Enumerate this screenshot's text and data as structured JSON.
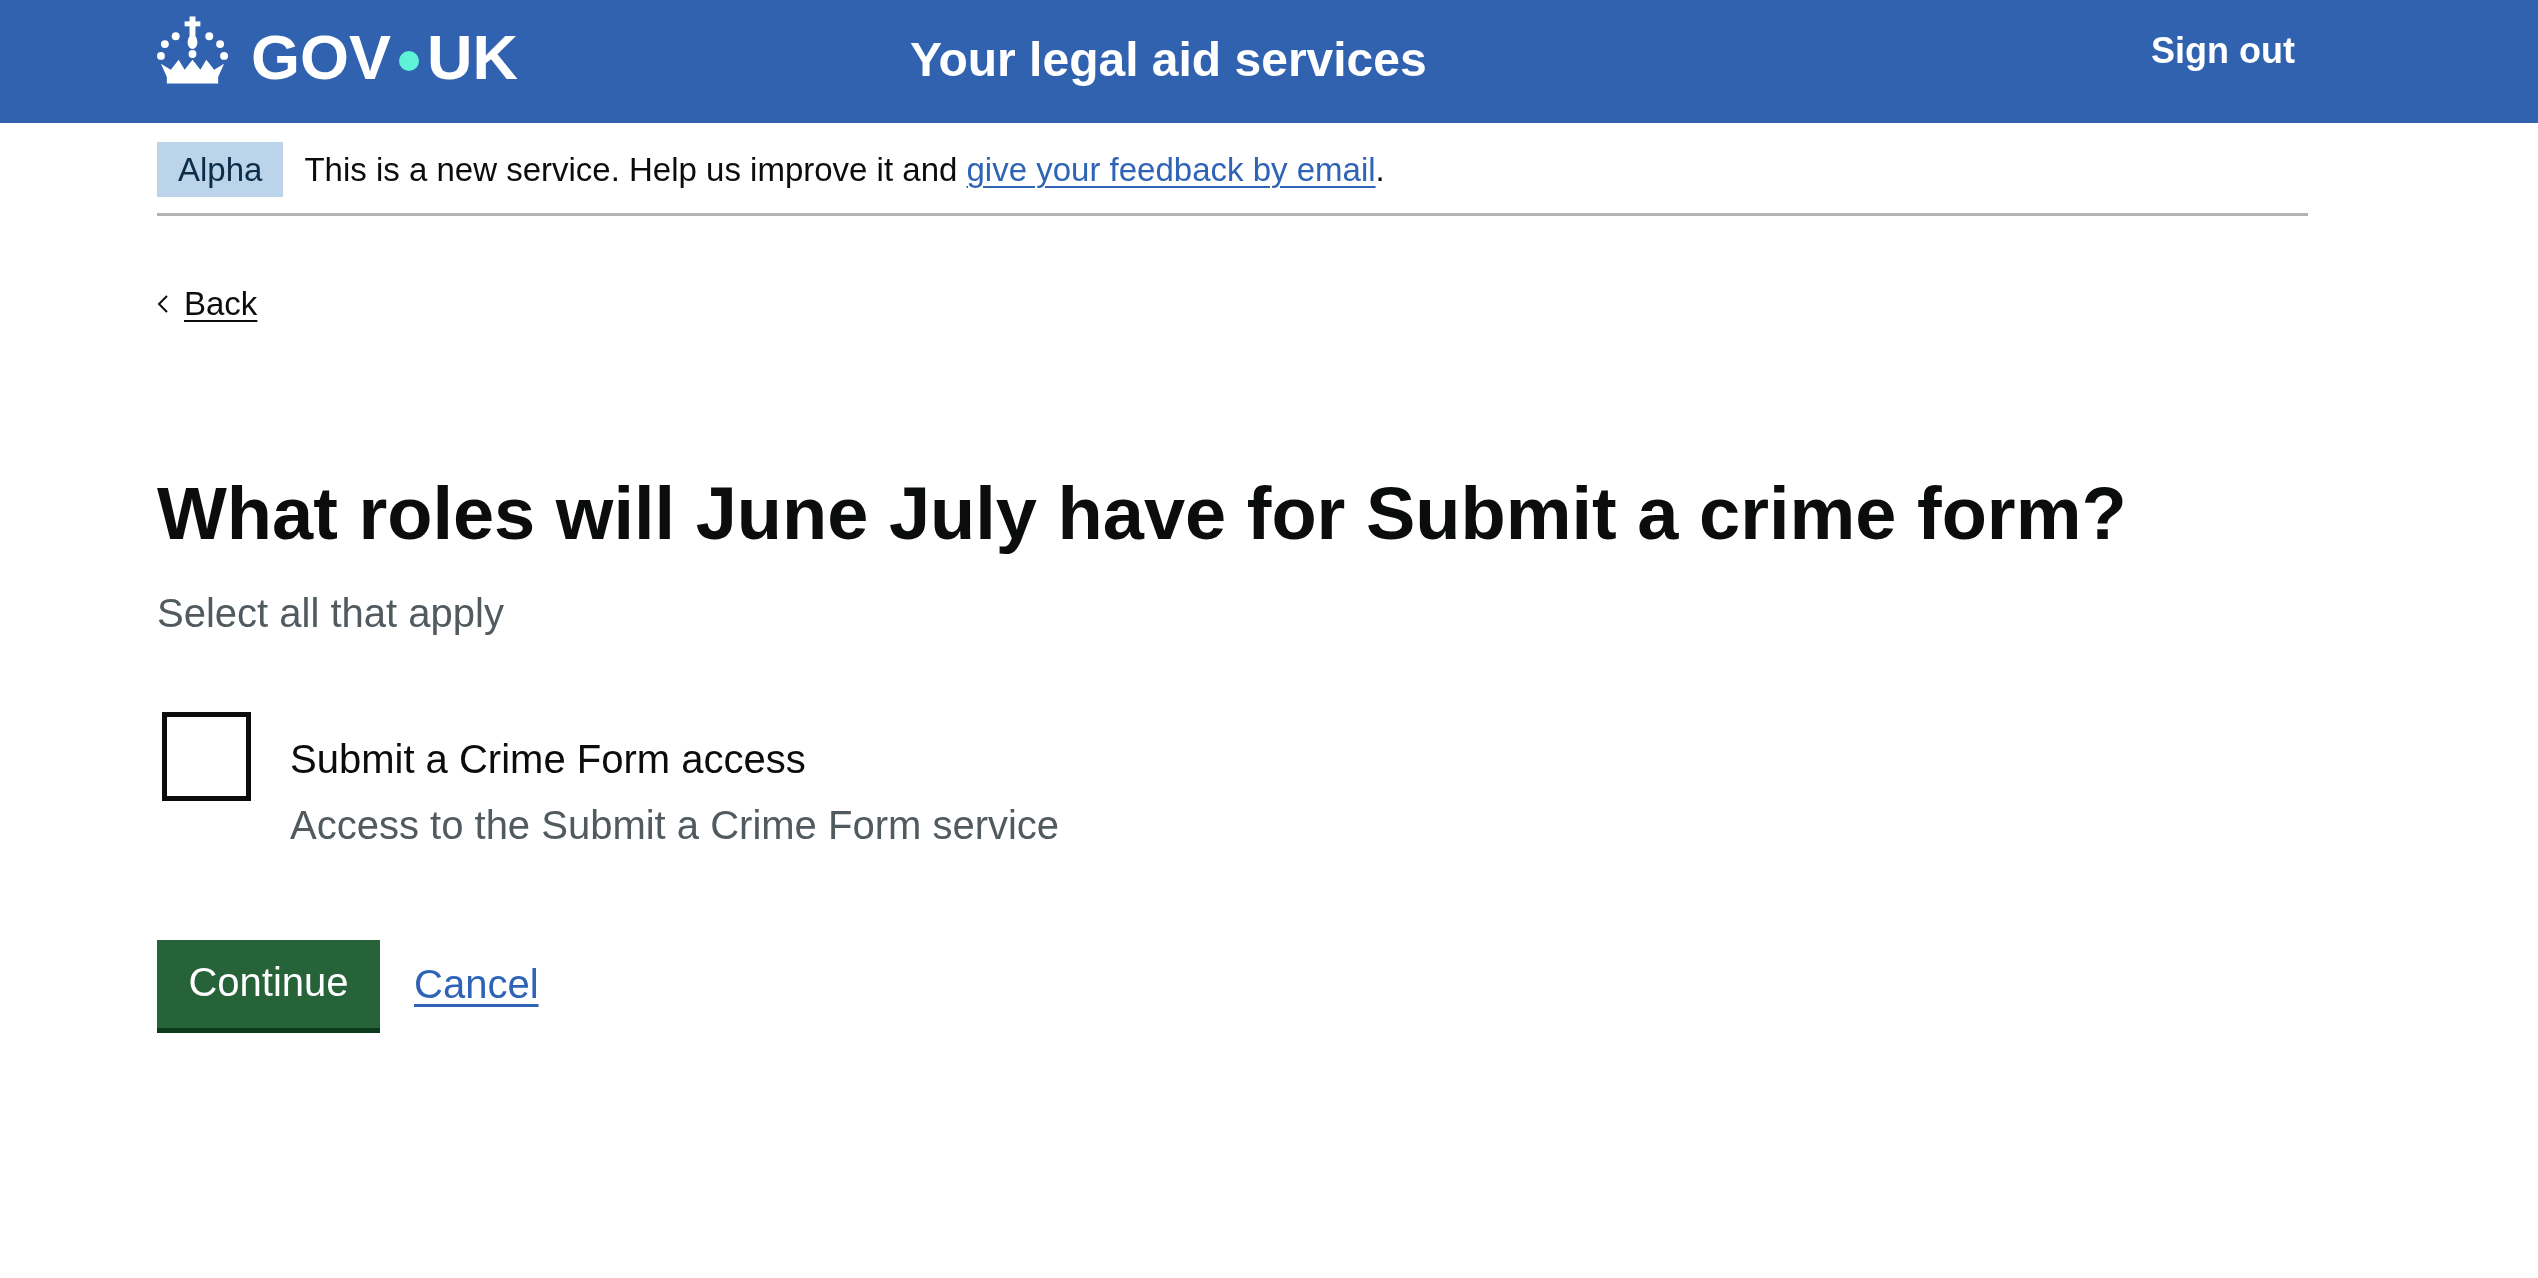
{
  "header": {
    "logo": {
      "left": "GOV",
      "right": "UK"
    },
    "service_name": "Your legal aid services",
    "sign_out": "Sign out"
  },
  "phase_banner": {
    "tag": "Alpha",
    "text": "This is a new service. Help us improve it and ",
    "link": "give your feedback by email",
    "text_end": "."
  },
  "back_link": "Back",
  "question": {
    "heading": "What roles will June July have for Submit a crime form?",
    "hint": "Select all that apply",
    "options": [
      {
        "label": "Submit a Crime Form access",
        "hint": "Access to the Submit a Crime Form service",
        "checked": false
      }
    ]
  },
  "actions": {
    "primary": "Continue",
    "secondary": "Cancel"
  }
}
